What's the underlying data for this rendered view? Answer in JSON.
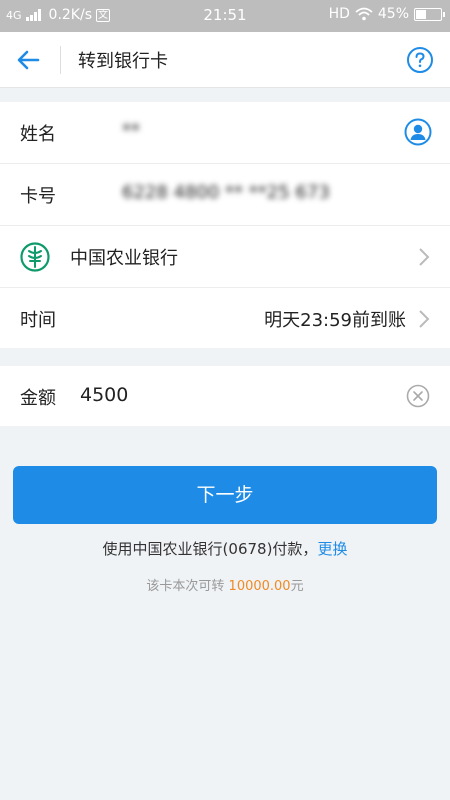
{
  "status_bar": {
    "network": "4G",
    "speed": "0.2K/s",
    "badge": "文",
    "time": "21:51",
    "hd": "HD",
    "battery": "45%",
    "battery_level": 0.45
  },
  "header": {
    "title": "转到银行卡"
  },
  "form": {
    "name_label": "姓名",
    "name_value": "**",
    "card_label": "卡号",
    "card_value": "6228 4800 ** **25 673",
    "bank_name": "中国农业银行",
    "time_label": "时间",
    "time_value": "明天23:59前到账",
    "amount_label": "金额",
    "amount_value": "4500"
  },
  "actions": {
    "next_label": "下一步",
    "pay_prefix": "使用中国农业银行(0678)付款，",
    "pay_change": "更换",
    "limit_prefix": "该卡本次可转 ",
    "limit_amount": "10000.00",
    "limit_suffix": "元"
  },
  "colors": {
    "accent": "#1e8ce6",
    "bank_green": "#0f9a6c",
    "limit_orange": "#f08a24"
  }
}
